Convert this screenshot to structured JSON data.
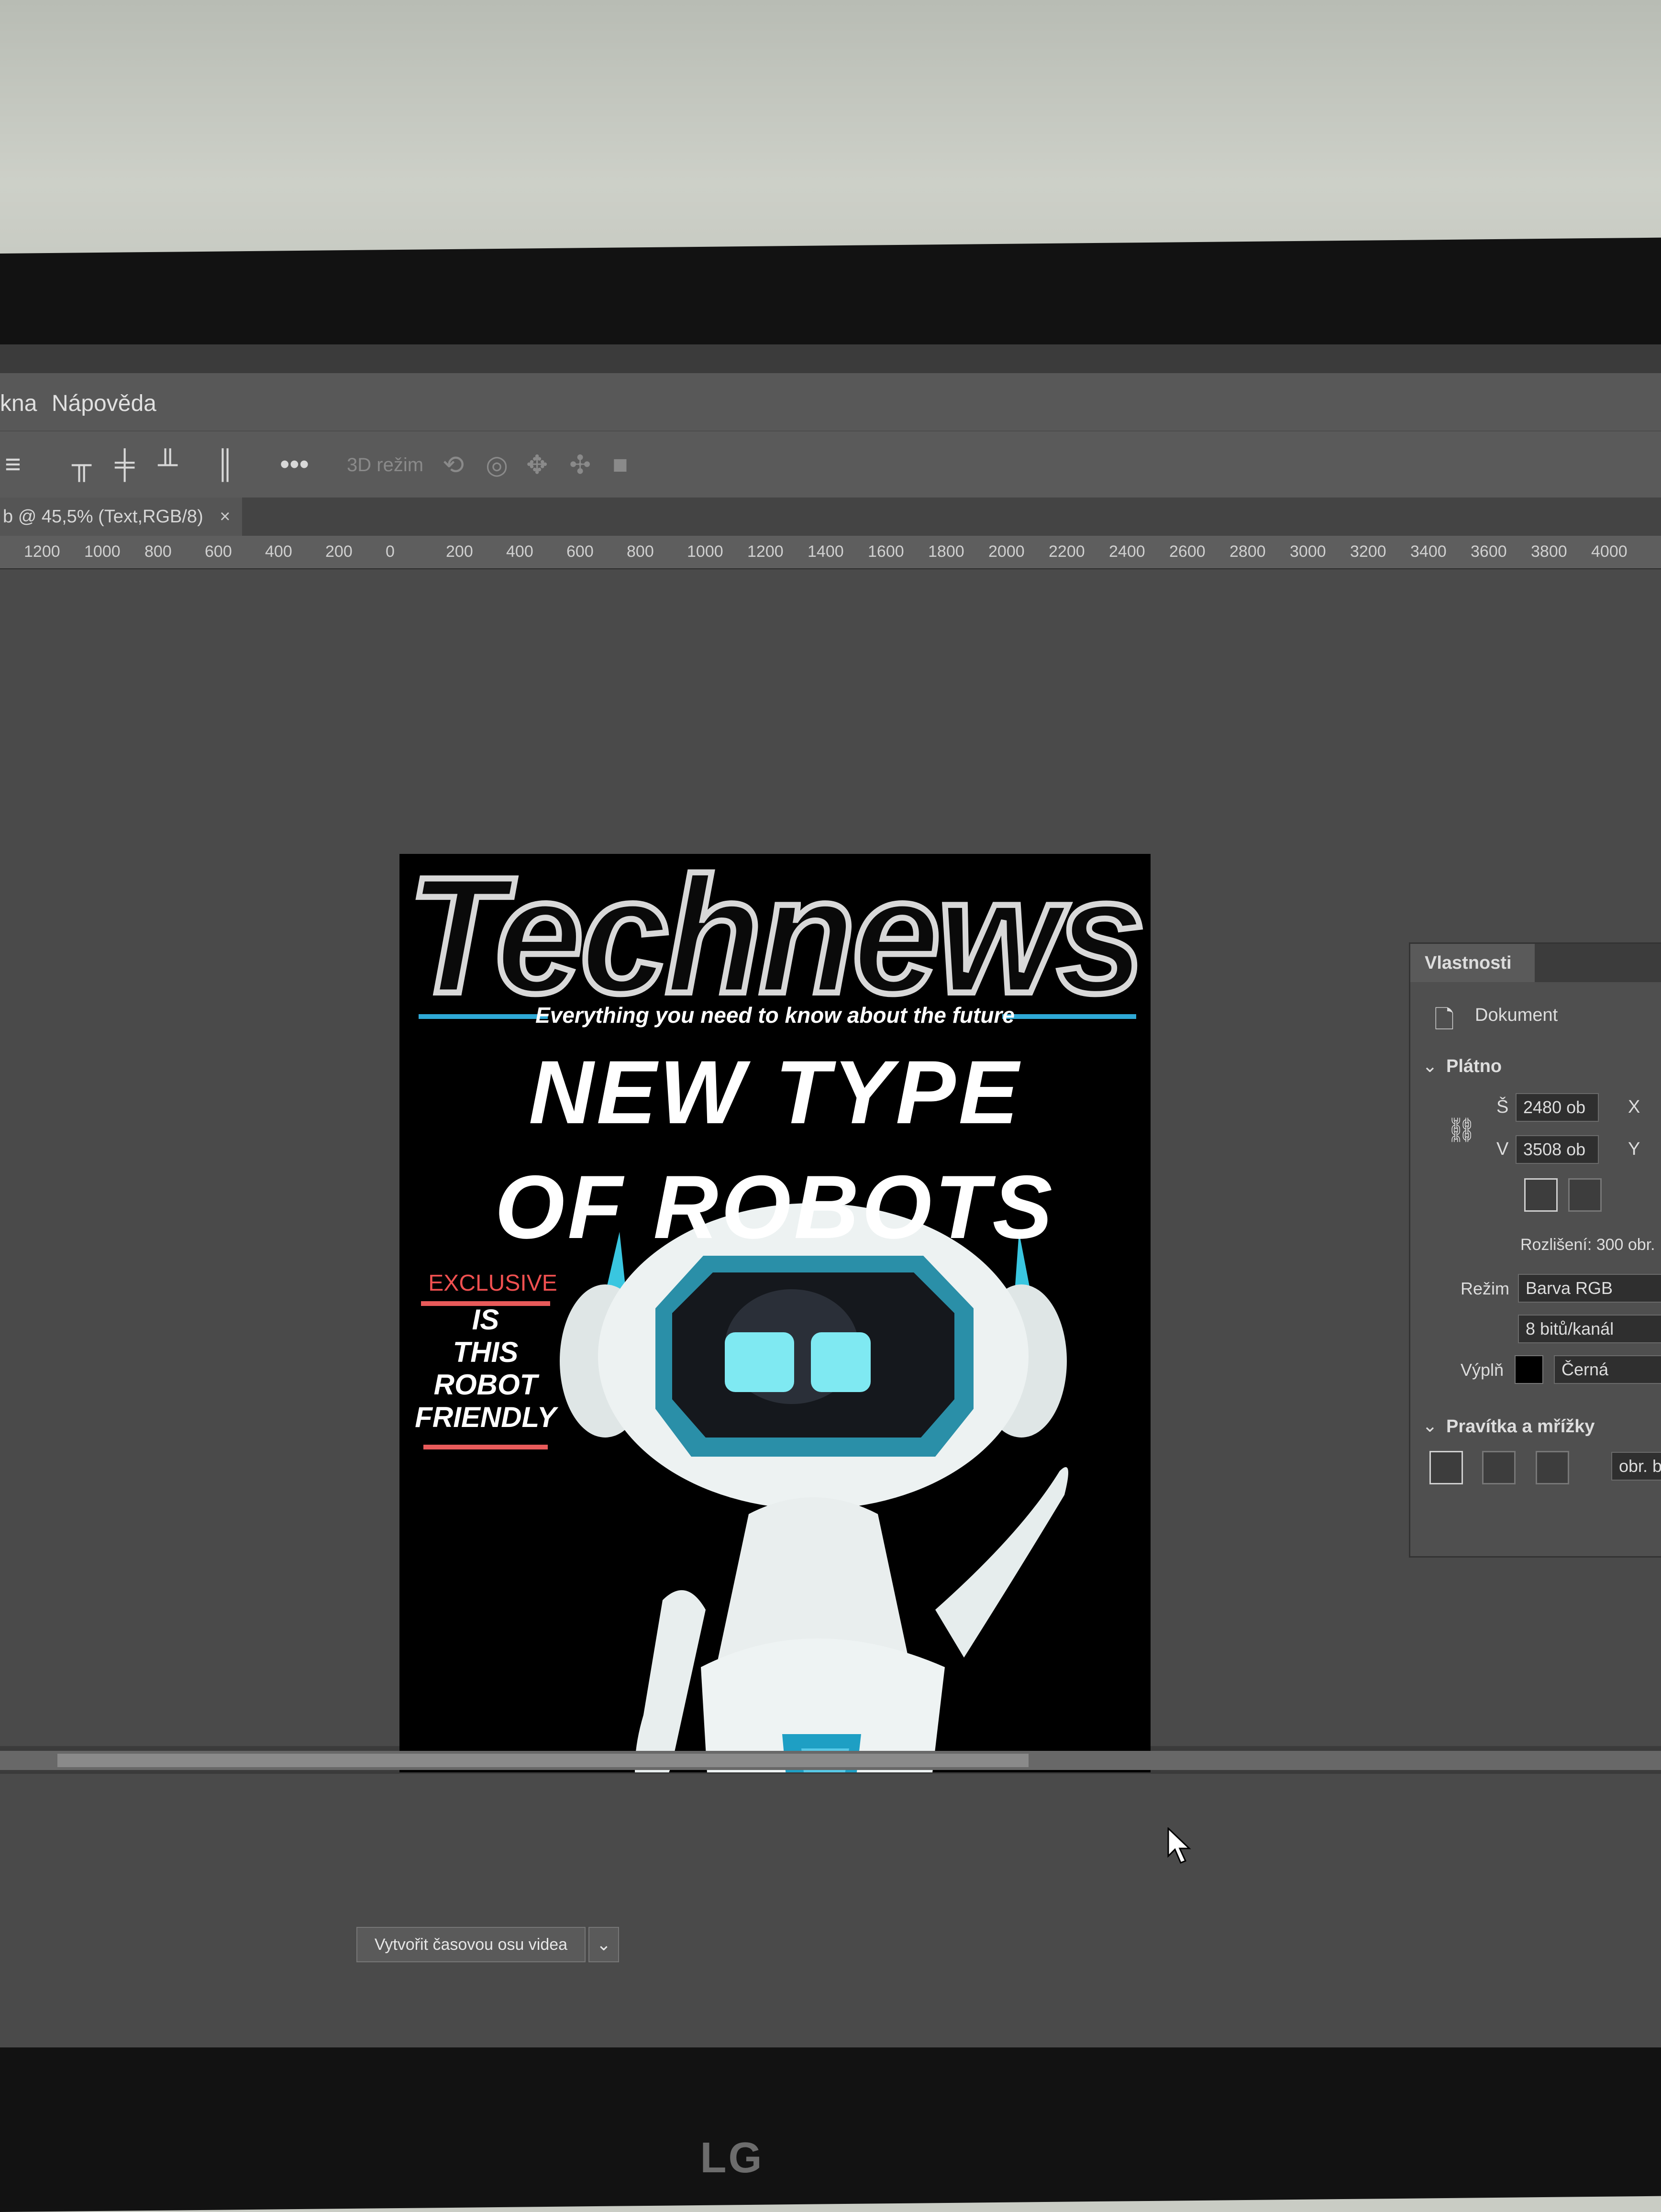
{
  "menu": {
    "item_okna": "kna",
    "item_help": "Nápověda"
  },
  "options": {
    "dots": "•••",
    "mode3d": "3D režim"
  },
  "document_tab": {
    "label": "b @ 45,5% (Text,RGB/8)",
    "close": "×"
  },
  "ruler_ticks": [
    "1200",
    "1000",
    "800",
    "600",
    "400",
    "200",
    "0",
    "200",
    "400",
    "600",
    "800",
    "1000",
    "1200",
    "1400",
    "1600",
    "1800",
    "2000",
    "2200",
    "2400",
    "2600",
    "2800",
    "3000",
    "3200",
    "3400",
    "3600",
    "3800",
    "4000"
  ],
  "poster": {
    "masthead": "Technews",
    "tagline": "Everything you need to know about the future",
    "headline_1": "NEW TYPE",
    "headline_2": "OF ROBOTS",
    "exclusive": "EXCLUSIVE",
    "side_lines": [
      "IS",
      "THIS",
      "ROBOT",
      "FRIENDLY"
    ],
    "colors": {
      "accent_cyan": "#2fa9d6",
      "accent_red": "#e85a5a"
    }
  },
  "properties": {
    "panel_title": "Vlastnosti",
    "document_label": "Dokument",
    "canvas_section": "Plátno",
    "width_label": "Š",
    "width_value": "2480 ob",
    "x_label": "X",
    "height_label": "V",
    "height_value": "3508 ob",
    "y_label": "Y",
    "resolution": "Rozlišení: 300 obr.",
    "mode_label": "Režim",
    "mode_value": "Barva RGB",
    "bits_value": "8 bitů/kanál",
    "fill_label": "Výplň",
    "fill_value": "Černá",
    "rulers_section": "Pravítka a mřížky",
    "unit_value": "obr. b"
  },
  "timeline": {
    "create_button": "Vytvořit časovou osu videa",
    "arrow": "⌄"
  },
  "monitor": {
    "brand": "LG"
  }
}
